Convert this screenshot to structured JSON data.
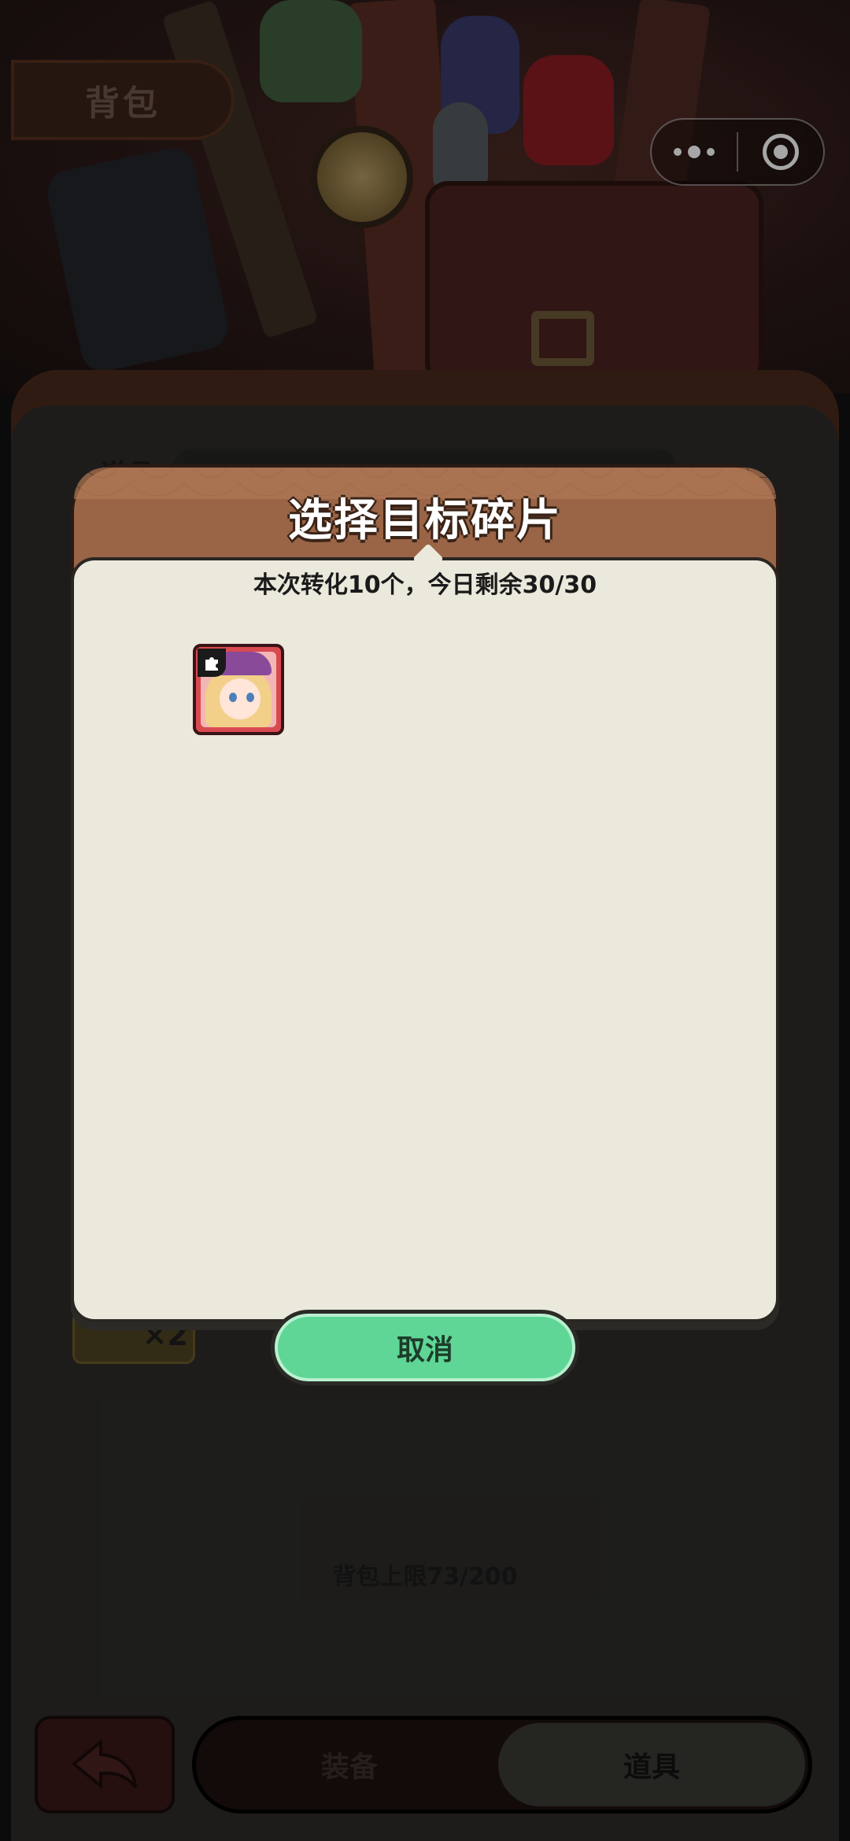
{
  "page": {
    "title": "背包",
    "capacity_label": "背包上限73/200"
  },
  "panel": {
    "tab_label": "道具",
    "item_count": "×2"
  },
  "bottom_nav": {
    "equip_label": "装备",
    "items_label": "道具"
  },
  "modal": {
    "title": "选择目标碎片",
    "subtitle": "本次转化10个，今日剩余30/30",
    "cancel_label": "取消",
    "fragments": [
      {
        "rarity_color": "#d84a50"
      }
    ]
  },
  "capsule": {
    "more_icon": "more-dots-icon",
    "close_icon": "target-circle-icon"
  }
}
